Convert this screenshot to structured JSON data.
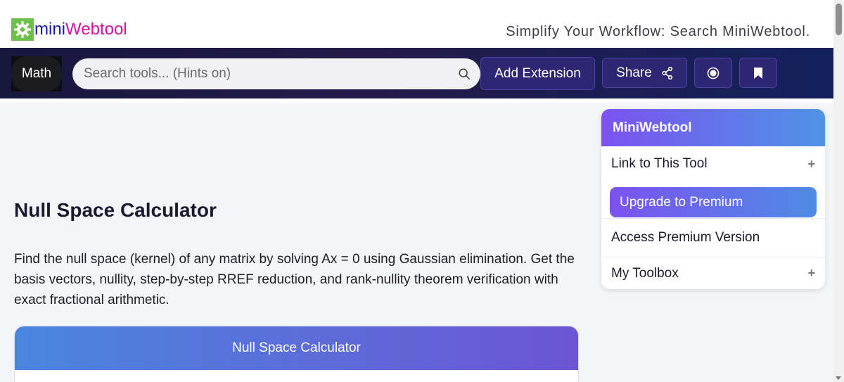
{
  "brand": {
    "logo_icon": "gear-icon",
    "logo_part1": "mini",
    "logo_part2": "Webtool",
    "tagline": "Simplify Your Workflow: Search MiniWebtool.",
    "colors": {
      "logo_green": "#6cc04a",
      "mini": "#1a1aa6",
      "webtool": "#d014a0"
    }
  },
  "navbar": {
    "math_label": "Math",
    "search_placeholder": "Search tools... (Hints on)",
    "search_icon": "search-icon",
    "extension_label": "Add Extension",
    "share_label": "Share",
    "share_icon": "share-icon",
    "record_icon": "record-icon",
    "bookmark_icon": "bookmark-icon"
  },
  "main": {
    "title": "Null Space Calculator",
    "description": "Find the null space (kernel) of any matrix by solving Ax = 0 using Gaussian elimination. Get the basis vectors, nullity, step-by-step RREF reduction, and rank-nullity theorem verification with exact fractional arithmetic.",
    "calculator_header": "Null Space Calculator"
  },
  "sidebar": {
    "header": "MiniWebtool",
    "link_label": "Link to This Tool",
    "premium_button": "Upgrade to Premium",
    "access_label": "Access Premium Version",
    "toolbox_label": "My Toolbox",
    "expand_symbol": "+"
  }
}
